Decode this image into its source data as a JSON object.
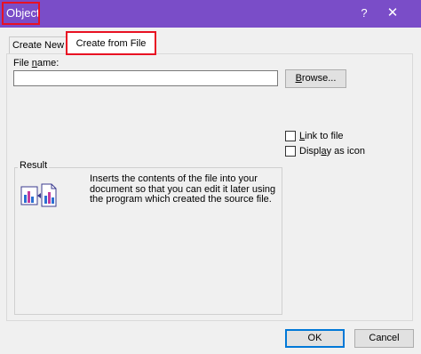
{
  "window": {
    "title": "Object",
    "help_glyph": "?",
    "close_glyph": "✕",
    "title_bar_color": "#7a4dc8"
  },
  "tabs": [
    {
      "label": "Create New"
    },
    {
      "label": "Create from File",
      "selected": true
    }
  ],
  "file": {
    "label_prefix": "File ",
    "label_underlined": "n",
    "label_suffix": "ame:",
    "value": "",
    "browse_underlined": "B",
    "browse_rest": "rowse..."
  },
  "options": {
    "link": {
      "underlined": "L",
      "rest": "ink to file",
      "checked": false
    },
    "display": {
      "prefix": "Displ",
      "underlined": "a",
      "suffix": "y as icon",
      "checked": false
    }
  },
  "result": {
    "caption": "Result",
    "description": "Inserts the contents of the file into your document so that you can edit it later using the program which created the source file.",
    "icon": "insert-file-icon"
  },
  "buttons": {
    "ok": "OK",
    "cancel": "Cancel"
  },
  "colors": {
    "highlight": "#e81123",
    "accent": "#0078d7"
  }
}
